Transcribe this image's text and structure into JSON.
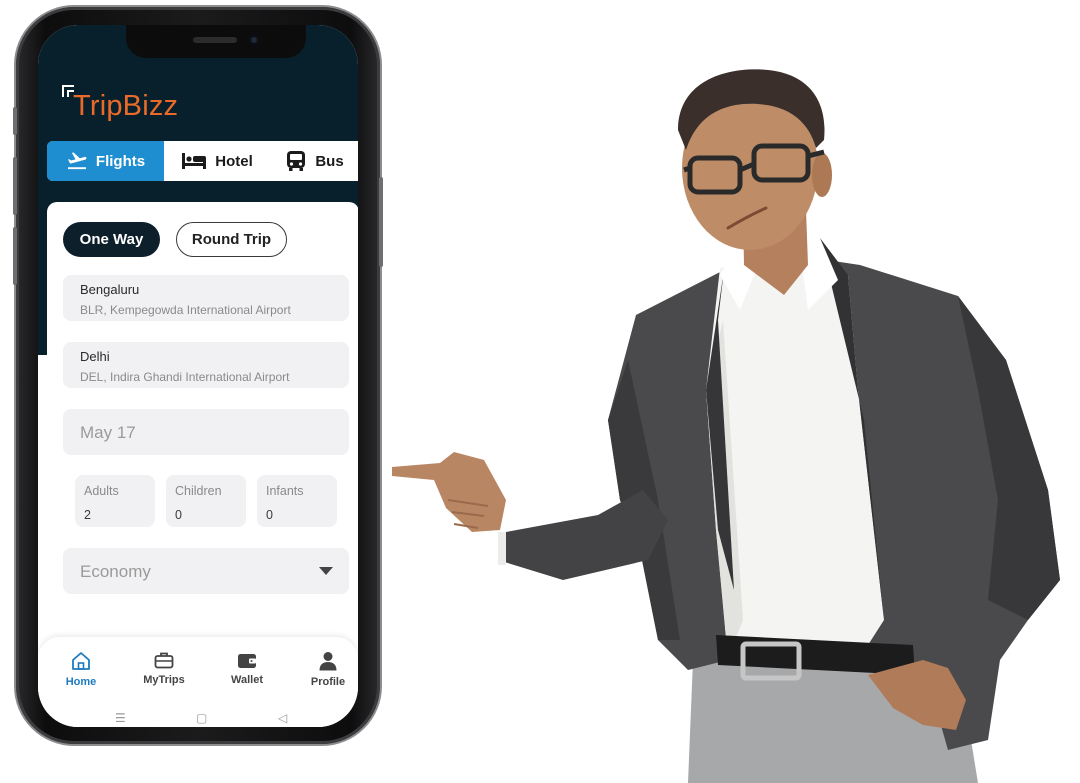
{
  "app": {
    "brand": "TripBizz",
    "colors": {
      "header": "#08202b",
      "accent": "#1e8ed0",
      "brand": "#ea6a2a",
      "dark_pill": "#0c1f2a"
    }
  },
  "tabs": [
    {
      "label": "Flights",
      "icon": "airplane-takeoff-icon",
      "active": true
    },
    {
      "label": "Hotel",
      "icon": "bed-icon",
      "active": false
    },
    {
      "label": "Bus",
      "icon": "bus-icon",
      "active": false
    }
  ],
  "trip_type": {
    "one_way": "One Way",
    "round_trip": "Round Trip",
    "selected": "One Way"
  },
  "from": {
    "city": "Bengaluru",
    "airport": "BLR, Kempegowda International Airport"
  },
  "to": {
    "city": "Delhi",
    "airport": "DEL, Indira Ghandi International Airport"
  },
  "date": {
    "value": "May 17"
  },
  "passengers": {
    "adults": {
      "label": "Adults",
      "value": "2"
    },
    "children": {
      "label": "Children",
      "value": "0"
    },
    "infants": {
      "label": "Infants",
      "value": "0"
    }
  },
  "cabin_class": {
    "value": "Economy",
    "icon": "caret-down-icon"
  },
  "bottom_nav": [
    {
      "label": "Home",
      "icon": "home-icon",
      "active": true
    },
    {
      "label": "MyTrips",
      "icon": "briefcase-icon",
      "active": false
    },
    {
      "label": "Wallet",
      "icon": "wallet-icon",
      "active": false
    },
    {
      "label": "Profile",
      "icon": "person-icon",
      "active": false
    }
  ],
  "system_nav": {
    "menu": "☰",
    "home": "▢",
    "back": "◁"
  }
}
